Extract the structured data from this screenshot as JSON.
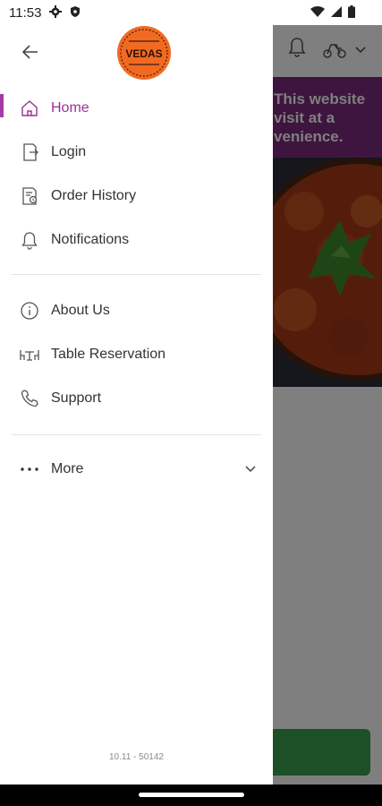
{
  "status_bar": {
    "time": "11:53"
  },
  "drawer": {
    "logo_text": "VEDAS",
    "menu_primary": [
      {
        "label": "Home",
        "icon": "home-icon",
        "active": true
      },
      {
        "label": "Login",
        "icon": "login-icon",
        "active": false
      },
      {
        "label": "Order History",
        "icon": "order-history-icon",
        "active": false
      },
      {
        "label": "Notifications",
        "icon": "bell-icon",
        "active": false
      }
    ],
    "menu_secondary": [
      {
        "label": "About Us",
        "icon": "info-icon"
      },
      {
        "label": "Table Reservation",
        "icon": "table-icon"
      },
      {
        "label": "Support",
        "icon": "phone-icon"
      }
    ],
    "more_label": "More",
    "version": "10.11 - 50142"
  },
  "background_app": {
    "promo_lines": [
      "This website",
      "visit at a",
      "venience."
    ]
  },
  "colors": {
    "accent": "#9b2f99",
    "promo_bg": "#7a2a7d",
    "button_green": "#3aa04d",
    "logo_orange": "#f26a21"
  }
}
